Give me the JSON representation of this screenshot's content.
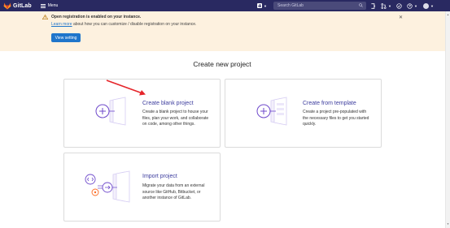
{
  "navbar": {
    "brand": "GitLab",
    "menu_label": "Menu",
    "search_placeholder": "Search GitLab"
  },
  "banner": {
    "title": "Open registration is enabled on your instance.",
    "link_text": "Learn more",
    "text_rest": " about how you can customize / disable registration on your instance.",
    "button_label": "View setting"
  },
  "main": {
    "heading": "Create new project",
    "cards": [
      {
        "title": "Create blank project",
        "desc_lines": [
          "Create a blank project to house your",
          "files, plan your work, and collaborate",
          "on code, among other things."
        ]
      },
      {
        "title": "Create from template",
        "desc_lines": [
          "Create a project pre-populated with",
          "the necessary files to get you started",
          "quickly."
        ]
      },
      {
        "title": "Import project",
        "desc_lines": [
          "Migrate your data from an external",
          "source like GitHub, Bitbucket, or",
          "another instance of GitLab."
        ]
      }
    ]
  },
  "colors": {
    "navbar": "#292961",
    "banner": "#fdf1df",
    "accent": "#1f75cb",
    "card_title": "#3d3d9e",
    "illustration": "#6e49cb",
    "annotation": "#e5252a"
  }
}
